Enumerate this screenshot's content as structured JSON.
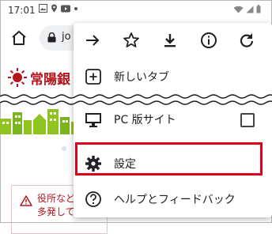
{
  "status_bar": {
    "time": "17:01"
  },
  "browser": {
    "url_text": "jo"
  },
  "page": {
    "logo_text": "常陽銀",
    "alert_lines": "役所など\n多発して"
  },
  "menu": {
    "actions": [
      "forward-icon",
      "bookmark-star-icon",
      "download-icon",
      "info-icon",
      "reload-icon"
    ],
    "items": [
      {
        "label": "新しいタブ",
        "icon": "plus-box-icon"
      },
      {
        "label": "PC 版サイト",
        "icon": "monitor-icon",
        "checked": false
      },
      {
        "label": "設定",
        "icon": "gear-icon",
        "highlighted": true
      },
      {
        "label": "ヘルプとフィードバック",
        "icon": "help-circle-icon"
      }
    ]
  },
  "colors": {
    "highlight": "#e0001b",
    "brand": "#b5161d",
    "skyline": "#8fc31f"
  }
}
